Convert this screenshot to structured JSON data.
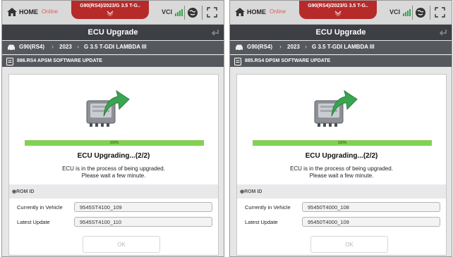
{
  "left": {
    "header": {
      "home_label": "HOME",
      "online": "Online",
      "vehicle": "G90(RS4)/2023/G 3.5 T-G..",
      "vci_label": "VCI"
    },
    "title": "ECU Upgrade",
    "breadcrumb": {
      "model": "G90(RS4)",
      "year": "2023",
      "engine": "G 3.5 T-GDI LAMBDA III"
    },
    "subheader": "886.RS4 APSM SOFTWARE UPDATE",
    "progress": {
      "percent": 100,
      "label": "100%"
    },
    "status": {
      "title": "ECU Upgrading...(2/2)",
      "line1": "ECU is in the process of being upgraded.",
      "line2": "Please wait a few minute."
    },
    "rom": {
      "header": "ROM ID",
      "rows": [
        {
          "label": "Currently in Vehicle",
          "value": "9545ST4100_109"
        },
        {
          "label": "Latest Update",
          "value": "9545ST4100_110"
        }
      ]
    },
    "ok_label": "OK"
  },
  "right": {
    "header": {
      "home_label": "HOME",
      "online": "Online",
      "vehicle": "G90(RS4)/2023/G 3.5 T-G..",
      "vci_label": "VCI"
    },
    "title": "ECU Upgrade",
    "breadcrumb": {
      "model": "G90(RS4)",
      "year": "2023",
      "engine": "G 3.5 T-GDI LAMBDA III"
    },
    "subheader": "885.RS4 DPSM SOFTWARE UPDATE",
    "progress": {
      "percent": 100,
      "label": "100%"
    },
    "status": {
      "title": "ECU Upgrading...(2/2)",
      "line1": "ECU is in the process of being upgraded.",
      "line2": "Please wait a few minute."
    },
    "rom": {
      "header": "ROM ID",
      "rows": [
        {
          "label": "Currently in Vehicle",
          "value": "95450T4000_108"
        },
        {
          "label": "Latest Update",
          "value": "95450T4000_109"
        }
      ]
    },
    "ok_label": "OK"
  },
  "colors": {
    "accent_red": "#b72a2a",
    "title_bar": "#3d3f44",
    "progress_green": "#7ed44f",
    "vci_green": "#2ea84a"
  },
  "icons": [
    "home-icon",
    "chevron-down-icon",
    "vci-signal-icon",
    "globe-icon",
    "fullscreen-icon",
    "back-icon",
    "car-icon",
    "document-icon",
    "ecu-upgrade-icon"
  ]
}
